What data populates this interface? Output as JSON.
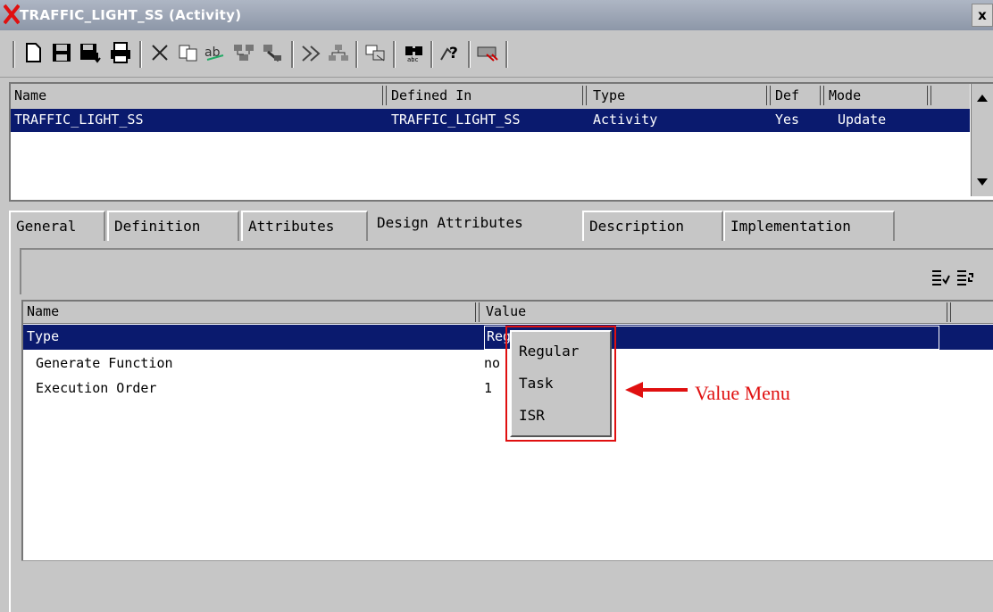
{
  "window": {
    "title": "TRAFFIC_LIGHT_SS (Activity)",
    "close_label": "x"
  },
  "toolbar": {
    "icons": [
      "new-file-icon",
      "save-icon",
      "save-as-icon",
      "print-icon",
      "delete-icon",
      "copy-icon",
      "spell-icon",
      "network-icon",
      "properties-icon",
      "relations-icon",
      "hierarchy-icon",
      "diagram-icon",
      "find-icon",
      "help-icon",
      "close-tool-icon"
    ]
  },
  "element_list": {
    "columns": [
      "Name",
      "Defined In",
      "Type",
      "Def",
      "Mode"
    ],
    "rows": [
      {
        "name": "TRAFFIC_LIGHT_SS",
        "defined_in": "TRAFFIC_LIGHT_SS",
        "type": "Activity",
        "def": "Yes",
        "mode": "Update"
      }
    ]
  },
  "tabs": [
    {
      "label": "General",
      "active": false
    },
    {
      "label": "Definition",
      "active": false
    },
    {
      "label": "Attributes",
      "active": false
    },
    {
      "label": "Design Attributes",
      "active": true
    },
    {
      "label": "Description",
      "active": false
    },
    {
      "label": "Implementation",
      "active": false
    }
  ],
  "design_attributes": {
    "columns": [
      "Name",
      "Value"
    ],
    "rows": [
      {
        "name": "Type",
        "value": "Regular",
        "selected": true
      },
      {
        "name": "Generate Function",
        "value": "no",
        "selected": false
      },
      {
        "name": "Execution Order",
        "value": "1",
        "selected": false
      }
    ]
  },
  "value_menu": {
    "options": [
      "Regular",
      "Task",
      "ISR"
    ]
  },
  "annotation": {
    "label": "Value Menu",
    "color": "#e01010"
  },
  "colors": {
    "selection": "#0a1a6e",
    "background": "#c6c6c6"
  }
}
